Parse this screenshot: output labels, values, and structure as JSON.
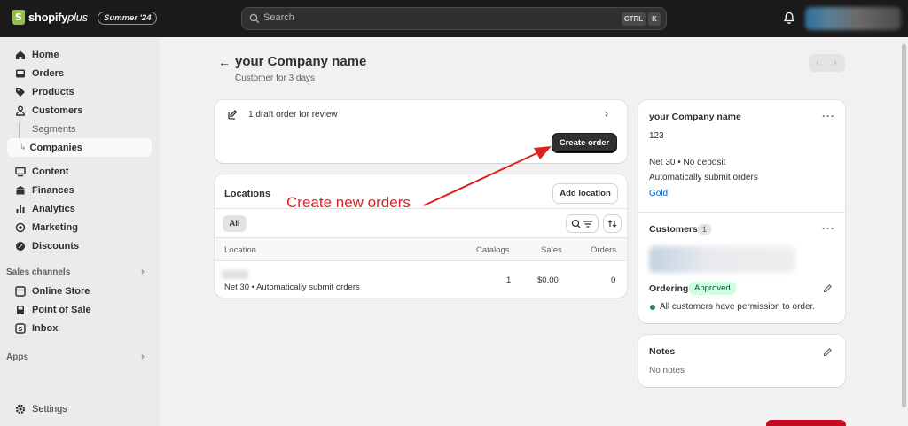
{
  "topbar": {
    "logo_text": "shopify",
    "logo_suffix": "plus",
    "edition": "Summer '24",
    "search_placeholder": "Search",
    "kbd_ctrl": "CTRL",
    "kbd_k": "K"
  },
  "sidebar": {
    "items": [
      {
        "label": "Home",
        "icon": "home-icon"
      },
      {
        "label": "Orders",
        "icon": "inbox-icon"
      },
      {
        "label": "Products",
        "icon": "tag-icon"
      },
      {
        "label": "Customers",
        "icon": "person-icon"
      },
      {
        "label": "Segments"
      },
      {
        "label": "Companies"
      },
      {
        "label": "Content",
        "icon": "content-icon"
      },
      {
        "label": "Finances",
        "icon": "bank-icon"
      },
      {
        "label": "Analytics",
        "icon": "bar-chart-icon"
      },
      {
        "label": "Marketing",
        "icon": "target-icon"
      },
      {
        "label": "Discounts",
        "icon": "discount-icon"
      }
    ],
    "sales_channels_label": "Sales channels",
    "channels": [
      {
        "label": "Online Store",
        "icon": "store-icon"
      },
      {
        "label": "Point of Sale",
        "icon": "pos-icon"
      },
      {
        "label": "Inbox",
        "icon": "chat-icon"
      }
    ],
    "apps_label": "Apps",
    "settings_label": "Settings"
  },
  "page": {
    "title": "your Company name",
    "subtitle": "Customer for 3 days"
  },
  "draft": {
    "text": "1 draft order for review",
    "create_order": "Create order"
  },
  "annotation": "Create new orders",
  "locations": {
    "title": "Locations",
    "add_location": "Add location",
    "filter_all": "All",
    "headers": {
      "location": "Location",
      "catalogs": "Catalogs",
      "sales": "Sales",
      "orders": "Orders"
    },
    "rows": [
      {
        "terms": "Net 30 • Automatically submit orders",
        "catalogs": "1",
        "sales": "$0.00",
        "orders": "0"
      }
    ]
  },
  "company": {
    "name": "your Company name",
    "id": "123",
    "terms": "Net 30 • No deposit",
    "auto_submit": "Automatically submit orders",
    "tier": "Gold",
    "customers_label": "Customers",
    "customers_count": "1",
    "ordering_label": "Ordering",
    "ordering_status": "Approved",
    "permission_text": "All customers have permission to order."
  },
  "notes": {
    "title": "Notes",
    "body": "No notes"
  },
  "colors": {
    "topbar": "#1a1a1a",
    "accent_link": "#005bd3",
    "approved_bg": "#cdfee1",
    "annotation_red": "#e02020"
  }
}
